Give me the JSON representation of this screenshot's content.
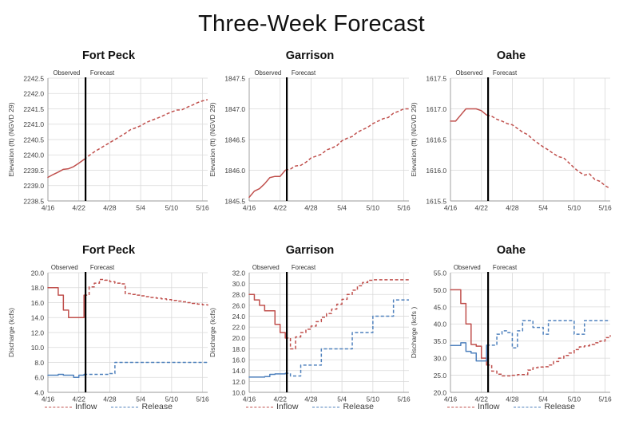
{
  "title": "Three-Week Forecast",
  "colors": {
    "inflow": "#C0504D",
    "release": "#4F81BD",
    "divider": "#000000",
    "grid": "#D9D9D9",
    "axis_text": "#404040"
  },
  "annotations": {
    "observed": "Observed",
    "forecast": "Forecast"
  },
  "legend": {
    "inflow_label": "Inflow",
    "release_label": "Release"
  },
  "chart_data": [
    {
      "id": "fort-peck-elevation",
      "type": "line",
      "title": "Fort Peck",
      "xlabel": "",
      "ylabel": "Elevation (ft) (NGVD 29)",
      "ylim": [
        2238.5,
        2242.5
      ],
      "yticks": [
        2238.5,
        2239.0,
        2239.5,
        2240.0,
        2240.5,
        2241.0,
        2241.5,
        2242.0,
        2242.5
      ],
      "ytick_labels": [
        "2238.5",
        "2239.0",
        "2239.5",
        "2240.0",
        "2240.5",
        "2241.0",
        "2241.5",
        "2242.0",
        "2242.5"
      ],
      "xticks": [
        0,
        6,
        12,
        18,
        24,
        30
      ],
      "xtick_labels": [
        "4/16",
        "4/22",
        "4/28",
        "5/4",
        "5/10",
        "5/16"
      ],
      "xlim": [
        0,
        31
      ],
      "grid": true,
      "divider_x": 7.3,
      "observed_label_x": 1.0,
      "forecast_label_x": 8.2,
      "series": [
        {
          "name": "Elevation",
          "color": "#C0504D",
          "observed_points": 8,
          "x": [
            0,
            1,
            2,
            3,
            4,
            5,
            6,
            7,
            8,
            9,
            10,
            11,
            12,
            13,
            14,
            15,
            16,
            17,
            18,
            19,
            20,
            21,
            22,
            23,
            24,
            25,
            26,
            27,
            28,
            29,
            30,
            31
          ],
          "values": [
            2239.27,
            2239.36,
            2239.44,
            2239.53,
            2239.55,
            2239.62,
            2239.73,
            2239.85,
            2239.98,
            2240.1,
            2240.2,
            2240.3,
            2240.4,
            2240.5,
            2240.6,
            2240.7,
            2240.82,
            2240.88,
            2240.95,
            2241.05,
            2241.12,
            2241.18,
            2241.25,
            2241.33,
            2241.4,
            2241.46,
            2241.47,
            2241.55,
            2241.62,
            2241.7,
            2241.76,
            2241.8
          ]
        }
      ]
    },
    {
      "id": "garrison-elevation",
      "type": "line",
      "title": "Garrison",
      "xlabel": "",
      "ylabel": "Elevation (ft) (NGVD 29)",
      "ylim": [
        1845.5,
        1847.5
      ],
      "yticks": [
        1845.5,
        1846.0,
        1846.5,
        1847.0,
        1847.5
      ],
      "ytick_labels": [
        "1845.5",
        "1846.0",
        "1846.5",
        "1847.0",
        "1847.5"
      ],
      "xticks": [
        0,
        6,
        12,
        18,
        24,
        30
      ],
      "xtick_labels": [
        "4/16",
        "4/22",
        "4/28",
        "5/4",
        "5/10",
        "5/16"
      ],
      "xlim": [
        0,
        31
      ],
      "grid": true,
      "divider_x": 7.3,
      "observed_label_x": 1.0,
      "forecast_label_x": 8.2,
      "series": [
        {
          "name": "Elevation",
          "color": "#C0504D",
          "observed_points": 8,
          "x": [
            0,
            1,
            2,
            3,
            4,
            5,
            6,
            7,
            8,
            9,
            10,
            11,
            12,
            13,
            14,
            15,
            16,
            17,
            18,
            19,
            20,
            21,
            22,
            23,
            24,
            25,
            26,
            27,
            28,
            29,
            30,
            31
          ],
          "values": [
            1845.56,
            1845.66,
            1845.7,
            1845.78,
            1845.88,
            1845.9,
            1845.9,
            1846.0,
            1846.02,
            1846.07,
            1846.08,
            1846.13,
            1846.2,
            1846.23,
            1846.26,
            1846.33,
            1846.36,
            1846.4,
            1846.48,
            1846.52,
            1846.55,
            1846.62,
            1846.66,
            1846.7,
            1846.76,
            1846.8,
            1846.84,
            1846.86,
            1846.93,
            1846.96,
            1847.0,
            1847.0
          ]
        }
      ]
    },
    {
      "id": "oahe-elevation",
      "type": "line",
      "title": "Oahe",
      "xlabel": "",
      "ylabel": "Elevation (ft) (NGVD 29)",
      "ylim": [
        1615.5,
        1617.5
      ],
      "yticks": [
        1615.5,
        1616.0,
        1616.5,
        1617.0,
        1617.5
      ],
      "ytick_labels": [
        "1615.5",
        "1616.0",
        "1616.5",
        "1617.0",
        "1617.5"
      ],
      "xticks": [
        0,
        6,
        12,
        18,
        24,
        30
      ],
      "xtick_labels": [
        "4/16",
        "4/22",
        "4/28",
        "5/4",
        "5/10",
        "5/16"
      ],
      "xlim": [
        0,
        31
      ],
      "grid": true,
      "divider_x": 7.3,
      "observed_label_x": 1.0,
      "forecast_label_x": 8.2,
      "series": [
        {
          "name": "Elevation",
          "color": "#C0504D",
          "observed_points": 8,
          "x": [
            0,
            1,
            2,
            3,
            4,
            5,
            6,
            7,
            8,
            9,
            10,
            11,
            12,
            13,
            14,
            15,
            16,
            17,
            18,
            19,
            20,
            21,
            22,
            23,
            24,
            25,
            26,
            27,
            28,
            29,
            30,
            31
          ],
          "values": [
            1616.8,
            1616.8,
            1616.9,
            1617.0,
            1617.0,
            1617.0,
            1616.97,
            1616.9,
            1616.88,
            1616.83,
            1616.8,
            1616.76,
            1616.74,
            1616.68,
            1616.62,
            1616.58,
            1616.5,
            1616.44,
            1616.38,
            1616.33,
            1616.27,
            1616.22,
            1616.2,
            1616.12,
            1616.04,
            1615.97,
            1615.92,
            1615.94,
            1615.85,
            1615.82,
            1615.75,
            1615.7
          ]
        }
      ]
    },
    {
      "id": "fort-peck-discharge",
      "type": "line",
      "title": "Fort Peck",
      "xlabel": "",
      "ylabel": "Discharge (kcfs)",
      "ylim": [
        4.0,
        20.0
      ],
      "yticks": [
        4.0,
        6.0,
        8.0,
        10.0,
        12.0,
        14.0,
        16.0,
        18.0,
        20.0
      ],
      "ytick_labels": [
        "4.0",
        "6.0",
        "8.0",
        "10.0",
        "12.0",
        "14.0",
        "16.0",
        "18.0",
        "20.0"
      ],
      "xticks": [
        0,
        6,
        12,
        18,
        24,
        30
      ],
      "xtick_labels": [
        "4/16",
        "4/22",
        "4/28",
        "5/4",
        "5/10",
        "5/16"
      ],
      "xlim": [
        0,
        31
      ],
      "grid": true,
      "divider_x": 7.3,
      "observed_label_x": 0.6,
      "forecast_label_x": 8.2,
      "series": [
        {
          "name": "Inflow",
          "color": "#C0504D",
          "observed_points": 8,
          "x": [
            0,
            1,
            2,
            3,
            4,
            5,
            6,
            7,
            8,
            9,
            10,
            11,
            12,
            13,
            14,
            15,
            16,
            17,
            18,
            19,
            20,
            21,
            22,
            23,
            24,
            25,
            26,
            27,
            28,
            29,
            30,
            31
          ],
          "values": [
            18.0,
            18.0,
            17.0,
            15.0,
            14.0,
            14.0,
            14.0,
            17.0,
            18.1,
            18.6,
            19.1,
            19.0,
            18.8,
            18.6,
            18.5,
            17.2,
            17.1,
            17.0,
            16.9,
            16.8,
            16.7,
            16.6,
            16.5,
            16.4,
            16.3,
            16.2,
            16.1,
            16.0,
            15.9,
            15.8,
            15.7,
            15.6
          ]
        },
        {
          "name": "Release",
          "color": "#4F81BD",
          "observed_points": 8,
          "x": [
            0,
            1,
            2,
            3,
            4,
            5,
            6,
            7,
            8,
            9,
            10,
            11,
            12,
            13,
            14,
            15,
            16,
            17,
            18,
            19,
            20,
            21,
            22,
            23,
            24,
            25,
            26,
            27,
            28,
            29,
            30,
            31
          ],
          "values": [
            6.3,
            6.3,
            6.4,
            6.3,
            6.3,
            6.0,
            6.3,
            6.4,
            6.4,
            6.4,
            6.4,
            6.4,
            6.5,
            8.0,
            8.0,
            8.0,
            8.0,
            8.0,
            8.0,
            8.0,
            8.0,
            8.0,
            8.0,
            8.0,
            8.0,
            8.0,
            8.0,
            8.0,
            8.0,
            8.0,
            8.0,
            8.0
          ]
        }
      ]
    },
    {
      "id": "garrison-discharge",
      "type": "line",
      "title": "Garrison",
      "xlabel": "",
      "ylabel": "Discharge (kcfs)",
      "ylim": [
        10.0,
        32.0
      ],
      "yticks": [
        10.0,
        12.0,
        14.0,
        16.0,
        18.0,
        20.0,
        22.0,
        24.0,
        26.0,
        28.0,
        30.0,
        32.0
      ],
      "ytick_labels": [
        "10.0",
        "12.0",
        "14.0",
        "16.0",
        "18.0",
        "20.0",
        "22.0",
        "24.0",
        "26.0",
        "28.0",
        "30.0",
        "32.0"
      ],
      "xticks": [
        0,
        6,
        12,
        18,
        24,
        30
      ],
      "xtick_labels": [
        "4/16",
        "4/22",
        "4/28",
        "5/4",
        "5/10",
        "5/16"
      ],
      "xlim": [
        0,
        31
      ],
      "grid": true,
      "divider_x": 7.3,
      "observed_label_x": 0.6,
      "forecast_label_x": 8.2,
      "series": [
        {
          "name": "Inflow",
          "color": "#C0504D",
          "observed_points": 8,
          "x": [
            0,
            1,
            2,
            3,
            4,
            5,
            6,
            7,
            8,
            9,
            10,
            11,
            12,
            13,
            14,
            15,
            16,
            17,
            18,
            19,
            20,
            21,
            22,
            23,
            24,
            25,
            26,
            27,
            28,
            29,
            30,
            31
          ],
          "values": [
            28.0,
            27.0,
            26.0,
            25.0,
            25.0,
            22.5,
            21.0,
            20.0,
            18.0,
            20.2,
            21.0,
            21.6,
            22.2,
            23.0,
            23.8,
            24.5,
            25.3,
            26.2,
            27.1,
            28.0,
            28.8,
            29.6,
            30.2,
            30.6,
            30.7,
            30.7,
            30.7,
            30.7,
            30.7,
            30.7,
            30.7,
            30.7
          ]
        },
        {
          "name": "Release",
          "color": "#4F81BD",
          "observed_points": 8,
          "x": [
            0,
            1,
            2,
            3,
            4,
            5,
            6,
            7,
            8,
            9,
            10,
            11,
            12,
            13,
            14,
            15,
            16,
            17,
            18,
            19,
            20,
            21,
            22,
            23,
            24,
            25,
            26,
            27,
            28,
            29,
            30,
            31
          ],
          "values": [
            12.8,
            12.8,
            12.8,
            12.9,
            13.3,
            13.4,
            13.4,
            13.5,
            13.0,
            13.0,
            15.0,
            15.0,
            15.0,
            15.0,
            18.0,
            18.0,
            18.0,
            18.0,
            18.0,
            18.0,
            21.0,
            21.0,
            21.0,
            21.0,
            24.0,
            24.0,
            24.0,
            24.0,
            27.0,
            27.0,
            27.0,
            27.0
          ]
        }
      ]
    },
    {
      "id": "oahe-discharge",
      "type": "line",
      "title": "Oahe",
      "xlabel": "",
      "ylabel": "Discharge (kcfs )",
      "ylim": [
        20.0,
        55.0
      ],
      "yticks": [
        20.0,
        25.0,
        30.0,
        35.0,
        40.0,
        45.0,
        50.0,
        55.0
      ],
      "ytick_labels": [
        "20.0",
        "25.0",
        "30.0",
        "35.0",
        "40.0",
        "45.0",
        "50.0",
        "55.0"
      ],
      "xticks": [
        0,
        6,
        12,
        18,
        24,
        30
      ],
      "xtick_labels": [
        "4/16",
        "4/22",
        "4/28",
        "5/4",
        "5/10",
        "5/16"
      ],
      "xlim": [
        0,
        31
      ],
      "grid": true,
      "divider_x": 7.3,
      "observed_label_x": 0.6,
      "forecast_label_x": 8.2,
      "series": [
        {
          "name": "Inflow",
          "color": "#C0504D",
          "observed_points": 8,
          "x": [
            0,
            1,
            2,
            3,
            4,
            5,
            6,
            7,
            8,
            9,
            10,
            11,
            12,
            13,
            14,
            15,
            16,
            17,
            18,
            19,
            20,
            21,
            22,
            23,
            24,
            25,
            26,
            27,
            28,
            29,
            30,
            31
          ],
          "values": [
            50.0,
            50.0,
            46.0,
            40.0,
            34.0,
            33.5,
            30.0,
            28.0,
            26.2,
            25.3,
            24.8,
            24.8,
            25.0,
            25.2,
            25.2,
            26.5,
            27.2,
            27.4,
            27.5,
            28.0,
            29.0,
            30.0,
            30.8,
            31.5,
            32.5,
            33.3,
            33.6,
            34.0,
            34.5,
            35.0,
            36.0,
            36.7
          ]
        },
        {
          "name": "Release",
          "color": "#4F81BD",
          "observed_points": 8,
          "x": [
            0,
            1,
            2,
            3,
            4,
            5,
            6,
            7,
            8,
            9,
            10,
            11,
            12,
            13,
            14,
            15,
            16,
            17,
            18,
            19,
            20,
            21,
            22,
            23,
            24,
            25,
            26,
            27,
            28,
            29,
            30,
            31
          ],
          "values": [
            33.7,
            33.7,
            34.5,
            32.0,
            31.5,
            29.2,
            29.2,
            33.8,
            33.8,
            37.0,
            38.0,
            37.5,
            33.0,
            38.0,
            41.0,
            41.0,
            39.0,
            39.0,
            37.0,
            41.0,
            41.0,
            41.0,
            41.0,
            41.0,
            37.0,
            37.0,
            41.0,
            41.0,
            41.0,
            41.0,
            41.0,
            41.0
          ]
        }
      ]
    }
  ]
}
